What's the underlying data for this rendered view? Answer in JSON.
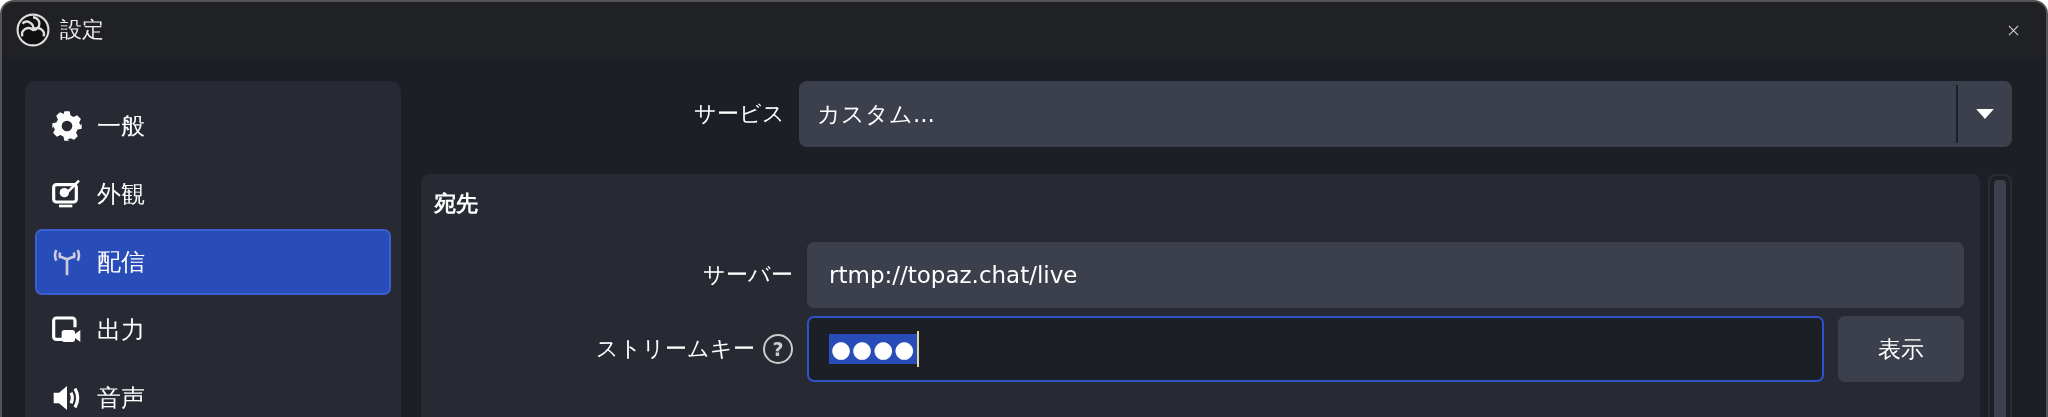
{
  "window": {
    "title": "設定"
  },
  "sidebar": {
    "items": [
      {
        "label": "一般",
        "kind": "gear",
        "selected": false
      },
      {
        "label": "外観",
        "kind": "appearance",
        "selected": false
      },
      {
        "label": "配信",
        "kind": "antenna",
        "selected": true
      },
      {
        "label": "出力",
        "kind": "output",
        "selected": false
      },
      {
        "label": "音声",
        "kind": "speaker",
        "selected": false
      }
    ]
  },
  "service": {
    "label": "サービス",
    "value": "カスタム..."
  },
  "destination": {
    "title": "宛先",
    "server": {
      "label": "サーバー",
      "value": "rtmp://topaz.chat/live"
    },
    "stream_key": {
      "label": "ストリームキー",
      "help": "?",
      "value": "●●●●",
      "text_selected": true,
      "focused": true
    },
    "show_button": "表示"
  }
}
